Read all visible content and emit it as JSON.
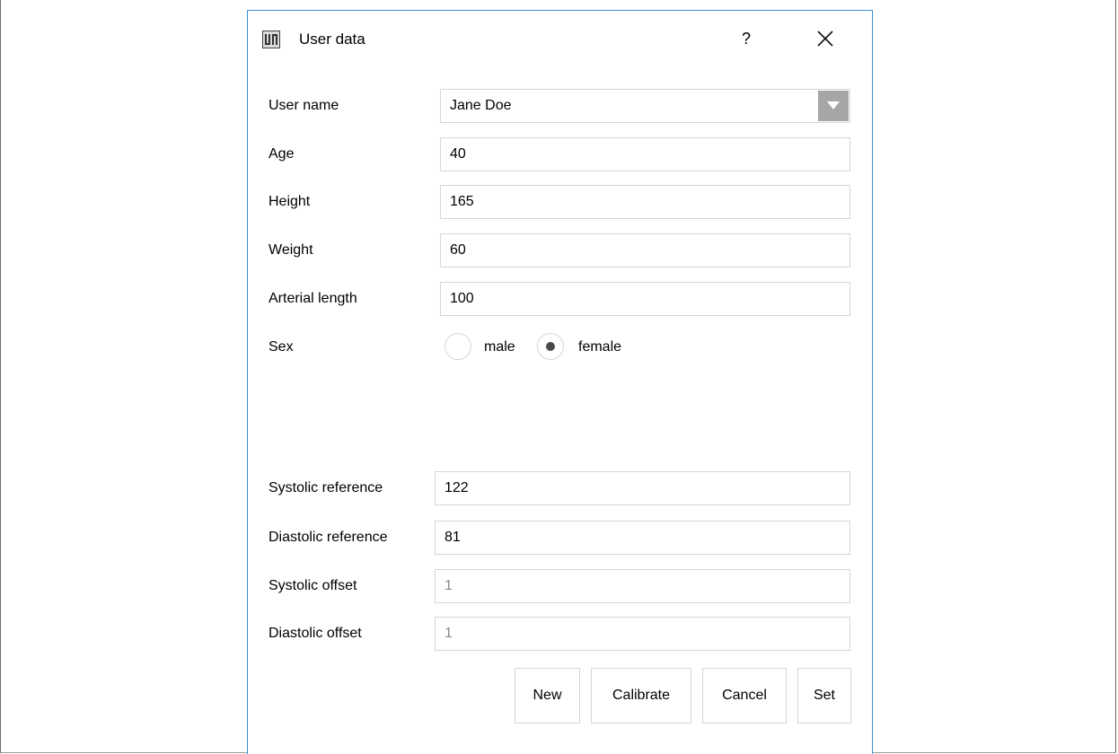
{
  "window": {
    "title": "User data",
    "help_label": "?"
  },
  "form": {
    "user_name": {
      "label": "User name",
      "value": "Jane Doe"
    },
    "age": {
      "label": "Age",
      "value": "40"
    },
    "height": {
      "label": "Height",
      "value": "165"
    },
    "weight": {
      "label": "Weight",
      "value": "60"
    },
    "arterial_length": {
      "label": "Arterial length",
      "value": "100"
    },
    "sex": {
      "label": "Sex",
      "options": [
        {
          "label": "male",
          "selected": false
        },
        {
          "label": "female",
          "selected": true
        }
      ]
    },
    "systolic_reference": {
      "label": "Systolic reference",
      "value": "122"
    },
    "diastolic_reference": {
      "label": "Diastolic reference",
      "value": "81"
    },
    "systolic_offset": {
      "label": "Systolic offset",
      "value": "1",
      "disabled": true
    },
    "diastolic_offset": {
      "label": "Diastolic offset",
      "value": "1",
      "disabled": true
    }
  },
  "buttons": {
    "new": "New",
    "calibrate": "Calibrate",
    "cancel": "Cancel",
    "set": "Set"
  },
  "colors": {
    "dialog_border": "#3c8fd6",
    "field_border": "#d6d6d6",
    "combo_arrow_bg": "#a6a6a6",
    "disabled_text": "#8a8a8a"
  },
  "icons": {
    "app": "app-logo-icon",
    "close": "close-icon",
    "dropdown": "chevron-down-icon"
  }
}
